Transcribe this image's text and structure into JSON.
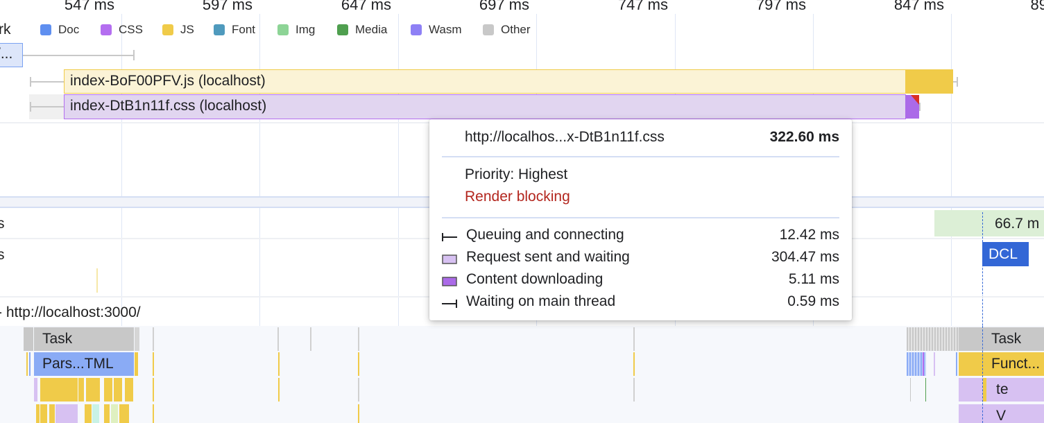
{
  "ruler": {
    "ticks": [
      "547 ms",
      "597 ms",
      "647 ms",
      "697 ms",
      "747 ms",
      "797 ms",
      "847 ms",
      "89"
    ]
  },
  "network": {
    "track_label_partial": "rk",
    "legend": [
      {
        "label": "Doc",
        "color": "#5f8ff0"
      },
      {
        "label": "CSS",
        "color": "#b46ef0"
      },
      {
        "label": "JS",
        "color": "#f0cb49"
      },
      {
        "label": "Font",
        "color": "#4f9abd"
      },
      {
        "label": "Img",
        "color": "#8dd496"
      },
      {
        "label": "Media",
        "color": "#4f9f4f"
      },
      {
        "label": "Wasm",
        "color": "#8e80f5"
      },
      {
        "label": "Other",
        "color": "#c8c8c8"
      }
    ],
    "requests": [
      {
        "label": "/...",
        "type": "Doc"
      },
      {
        "label": "index-BoF00PFV.js (localhost)",
        "type": "JS"
      },
      {
        "label": "index-DtB1n11f.css (localhost)",
        "type": "CSS"
      }
    ]
  },
  "tooltip": {
    "url": "http://localhos...x-DtB1n11f.css",
    "duration": "322.60 ms",
    "priority": "Priority: Highest",
    "render_blocking": "Render blocking",
    "phases": [
      {
        "icon": "queuing-whisker-icon",
        "label": "Queuing and connecting",
        "value": "12.42 ms"
      },
      {
        "icon": "request-waiting-swatch-icon",
        "label": "Request sent and waiting",
        "value": "304.47 ms"
      },
      {
        "icon": "content-downloading-swatch-icon",
        "label": "Content downloading",
        "value": "5.11 ms"
      },
      {
        "icon": "main-thread-whisker-icon",
        "label": "Waiting on main thread",
        "value": "0.59 ms"
      }
    ]
  },
  "tracks": {
    "frames_label_partial": "s",
    "timings_label_partial": "s",
    "frame_value": "66.7 m",
    "dcl_label": "DCL",
    "main_thread_label": "- http://localhost:3000/"
  },
  "main_thread": {
    "left_task": "Task",
    "left_parse": "Pars...TML",
    "right_task": "Task",
    "right_function": "Funct...",
    "right_te": "te",
    "right_v": "V"
  }
}
